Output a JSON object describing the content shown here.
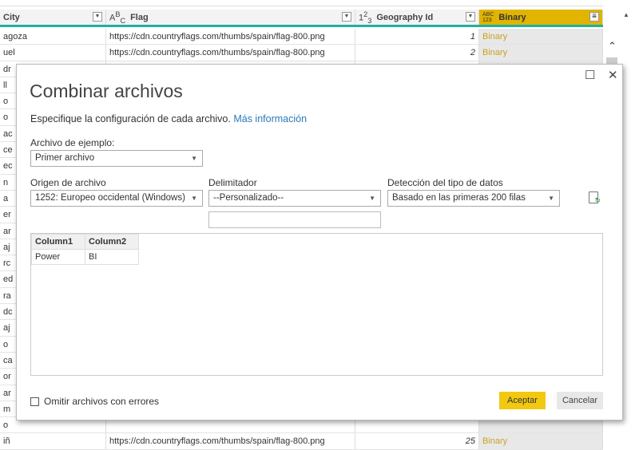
{
  "table": {
    "columns": [
      {
        "name": "City",
        "type": ""
      },
      {
        "name": "Flag",
        "type": "ABC"
      },
      {
        "name": "Geography Id",
        "type": "123"
      },
      {
        "name": "Binary",
        "type": "ABC123"
      }
    ],
    "rows": [
      [
        "agoza",
        "https://cdn.countryflags.com/thumbs/spain/flag-800.png",
        "1",
        "Binary"
      ],
      [
        "uel",
        "https://cdn.countryflags.com/thumbs/spain/flag-800.png",
        "2",
        "Binary"
      ],
      [
        "dr",
        "",
        "",
        ""
      ],
      [
        "ll",
        "",
        "",
        ""
      ],
      [
        "o",
        "",
        "",
        ""
      ],
      [
        "o",
        "",
        "",
        ""
      ],
      [
        "ac",
        "",
        "",
        ""
      ],
      [
        "ce",
        "",
        "",
        ""
      ],
      [
        "ec",
        "",
        "",
        ""
      ],
      [
        "n",
        "",
        "",
        ""
      ],
      [
        "a",
        "",
        "",
        ""
      ],
      [
        "er",
        "",
        "",
        ""
      ],
      [
        "ar",
        "",
        "",
        ""
      ],
      [
        "aj",
        "",
        "",
        ""
      ],
      [
        "rc",
        "",
        "",
        ""
      ],
      [
        "ed",
        "",
        "",
        ""
      ],
      [
        "ra",
        "",
        "",
        ""
      ],
      [
        "dc",
        "",
        "",
        ""
      ],
      [
        "aj",
        "",
        "",
        ""
      ],
      [
        "o",
        "",
        "",
        ""
      ],
      [
        "ca",
        "",
        "",
        ""
      ],
      [
        "or",
        "",
        "",
        ""
      ],
      [
        "ar",
        "",
        "",
        ""
      ],
      [
        "m",
        "",
        "",
        ""
      ],
      [
        "o",
        "",
        "",
        ""
      ],
      [
        "iñ",
        "https://cdn.countryflags.com/thumbs/spain/flag-800.png",
        "25",
        "Binary"
      ]
    ],
    "accent": "#1fb1a2",
    "binary_header_color": "#e0b400"
  },
  "dialog": {
    "title": "Combinar archivos",
    "description": "Especifique la configuración de cada archivo.",
    "more_info_link": "Más información",
    "sample_file_label": "Archivo de ejemplo:",
    "sample_file_value": "Primer archivo",
    "file_origin_label": "Origen de archivo",
    "file_origin_value": "1252: Europeo occidental (Windows)",
    "delimiter_label": "Delimitador",
    "delimiter_value": "--Personalizado--",
    "custom_delimiter_value": "",
    "detection_label": "Detección del tipo de datos",
    "detection_value": "Basado en las primeras 200 filas",
    "preview": {
      "headers": [
        "Column1",
        "Column2"
      ],
      "rows": [
        [
          "Power",
          "BI"
        ]
      ]
    },
    "skip_errors_label": "Omitir archivos con errores",
    "skip_errors_checked": false,
    "ok_label": "Aceptar",
    "cancel_label": "Cancelar",
    "ok_color": "#f2c811"
  }
}
